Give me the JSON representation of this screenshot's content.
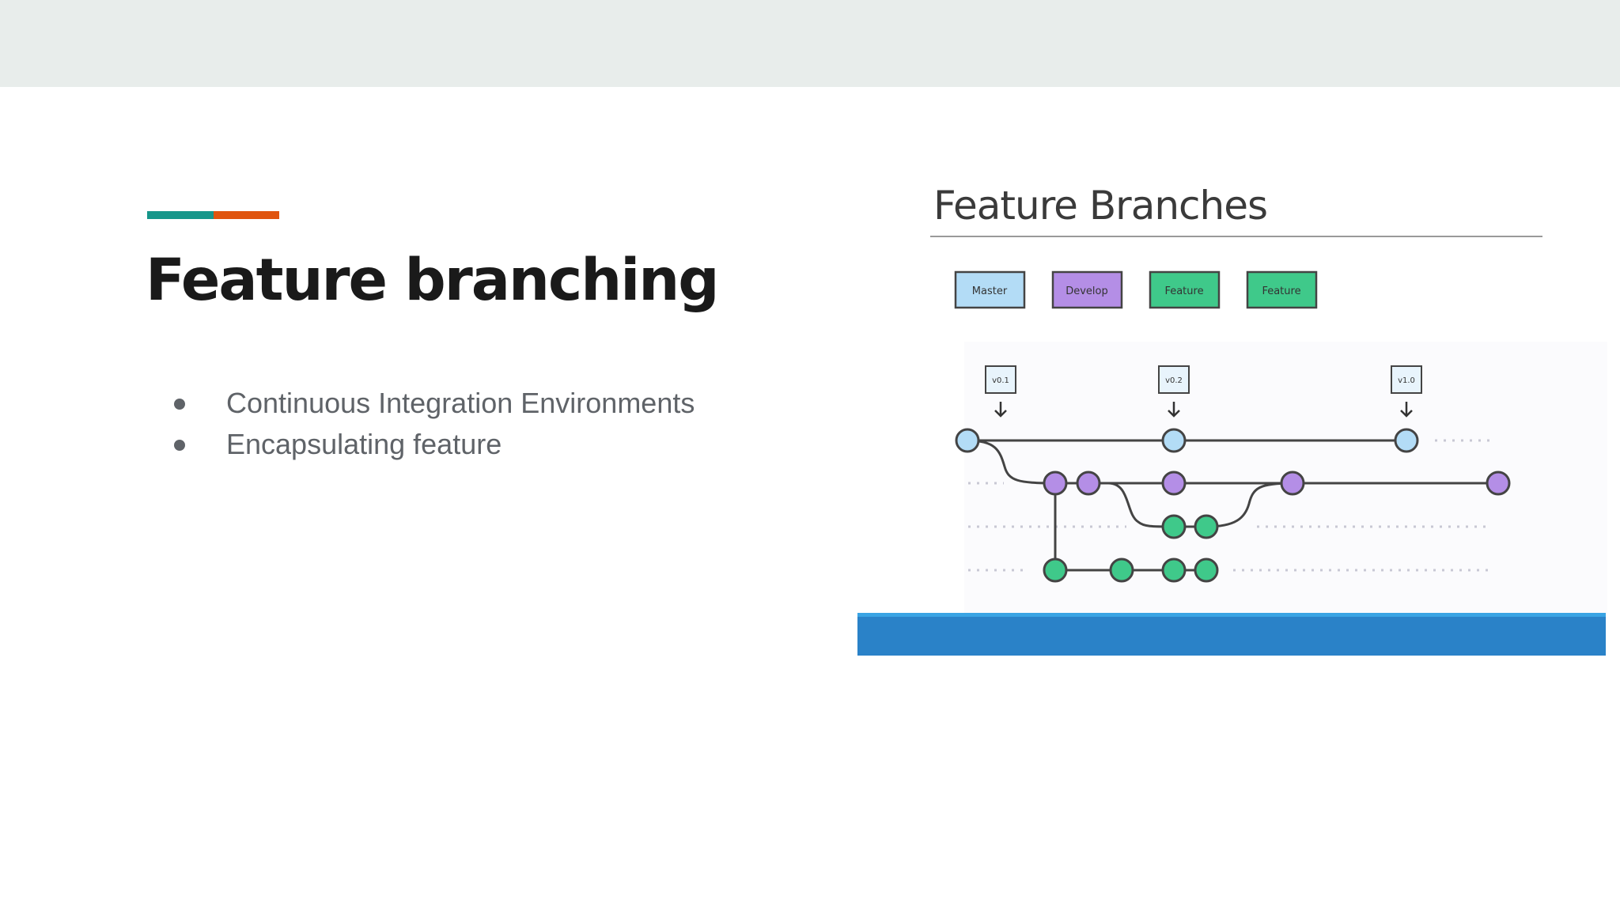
{
  "slide": {
    "title": "Feature branching",
    "bullets": [
      "Continuous Integration Environments",
      "Encapsulating feature"
    ]
  },
  "diagram": {
    "title": "Feature Branches",
    "legend": [
      {
        "label": "Master",
        "color": "#b3dcf6"
      },
      {
        "label": "Develop",
        "color": "#b48ee6"
      },
      {
        "label": "Feature",
        "color": "#3fc98a"
      },
      {
        "label": "Feature",
        "color": "#3fc98a"
      }
    ],
    "tags": [
      "v0.1",
      "v0.2",
      "v1.0"
    ],
    "colors": {
      "master": "#b3dcf6",
      "develop": "#b48ee6",
      "feature": "#3fc98a",
      "line": "#444444",
      "dotted": "#c8c8d4",
      "bottom_bar": "#2a82c8",
      "bottom_bar_top": "#3aa4e4",
      "accent_teal": "#16968a",
      "accent_orange": "#e0540e"
    }
  }
}
